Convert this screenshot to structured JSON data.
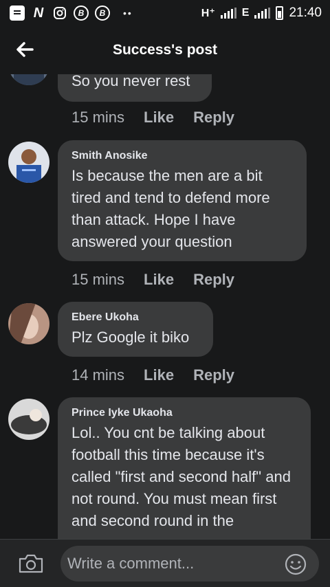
{
  "status_bar": {
    "left_icons": [
      "message-icon",
      "app-n-icon",
      "instagram-icon",
      "b-circle-icon",
      "b-circle-icon"
    ],
    "b_letter": "B",
    "n_letter": "N",
    "dots": "••",
    "network_1": "H⁺",
    "network_2": "E",
    "time": "21:40"
  },
  "header": {
    "title": "Success's post"
  },
  "comments": [
    {
      "author": "",
      "text": "So you never rest",
      "time": "15 mins",
      "like": "Like",
      "reply": "Reply"
    },
    {
      "author": "Smith Anosike",
      "text": "Is because the men are a bit tired and tend to defend more than attack. Hope I have answered your question",
      "time": "15 mins",
      "like": "Like",
      "reply": "Reply"
    },
    {
      "author": "Ebere Ukoha",
      "text": "Plz Google it biko",
      "time": "14 mins",
      "like": "Like",
      "reply": "Reply"
    },
    {
      "author": "Prince Iyke Ukaoha",
      "text": "Lol.. You cnt be talking about football this time because it's called \"first and second half\" and not round. You must mean first and second round in the",
      "time": "",
      "like": "",
      "reply": ""
    }
  ],
  "composer": {
    "placeholder": "Write a comment...",
    "camera_icon": "camera-icon",
    "emoji_icon": "emoji-icon"
  },
  "colors": {
    "background": "#18191a",
    "bubble": "#3a3b3c",
    "text": "#e4e6eb",
    "secondary_text": "#b0b3b8"
  }
}
